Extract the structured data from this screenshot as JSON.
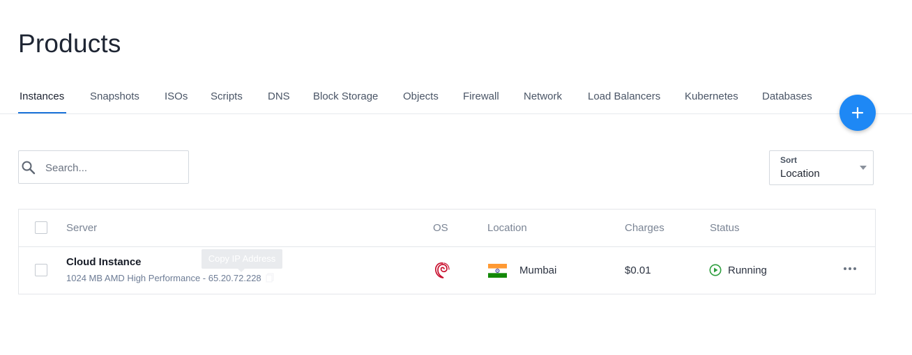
{
  "page": {
    "title": "Products"
  },
  "tabs": [
    {
      "label": "Instances",
      "active": true
    },
    {
      "label": "Snapshots"
    },
    {
      "label": "ISOs"
    },
    {
      "label": "Scripts"
    },
    {
      "label": "DNS"
    },
    {
      "label": "Block Storage"
    },
    {
      "label": "Objects"
    },
    {
      "label": "Firewall"
    },
    {
      "label": "Network"
    },
    {
      "label": "Load Balancers"
    },
    {
      "label": "Kubernetes"
    },
    {
      "label": "Databases"
    }
  ],
  "fab": {
    "icon": "plus-icon",
    "color": "#1e88f5"
  },
  "search": {
    "placeholder": "Search...",
    "value": "",
    "icon": "search-icon"
  },
  "sort": {
    "label": "Sort",
    "value": "Location"
  },
  "table": {
    "columns": [
      "Server",
      "OS",
      "Location",
      "Charges",
      "Status"
    ],
    "rows": [
      {
        "server": "Cloud Instance",
        "details": "1024 MB AMD High Performance - 65.20.72.228",
        "tooltip": "Copy IP Address",
        "os_icon": "debian-logo-icon",
        "location_flag": "india-flag-icon",
        "location": "Mumbai",
        "charges": "$0.01",
        "status": "Running",
        "status_icon": "play-circle-icon",
        "status_color": "#2e9e3e"
      }
    ]
  },
  "colors": {
    "accent": "#1a73d9",
    "os_logo": "#c8102e"
  }
}
